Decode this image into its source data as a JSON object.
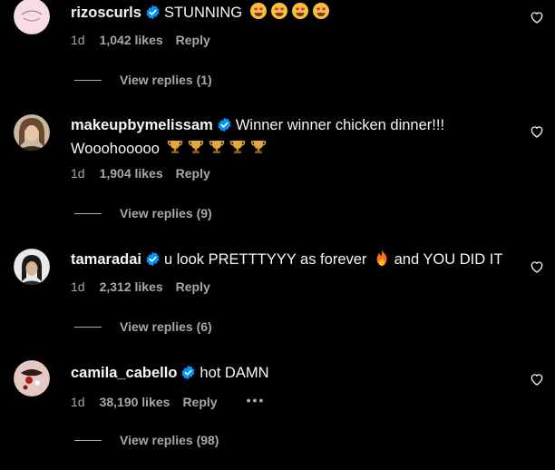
{
  "colors": {
    "background": "#000000",
    "text_primary": "#f5f5f5",
    "text_secondary": "#a8a8a8",
    "verified": "#0095f6"
  },
  "comments": [
    {
      "username": "rizoscurls",
      "verified": true,
      "text": "STUNNING",
      "emoji": [
        "smiling-face-with-heart-eyes",
        "smiling-face-with-heart-eyes",
        "smiling-face-with-heart-eyes",
        "smiling-face-with-heart-eyes"
      ],
      "time": "1d",
      "likes": "1,042 likes",
      "reply_label": "Reply",
      "view_replies": "View replies (1)"
    },
    {
      "username": "makeupbymelissam",
      "verified": true,
      "text": "Winner winner chicken dinner!!!",
      "text_line2": "Wooohooooo",
      "emoji": [
        "trophy",
        "trophy",
        "trophy",
        "trophy",
        "trophy"
      ],
      "time": "1d",
      "likes": "1,904 likes",
      "reply_label": "Reply",
      "view_replies": "View replies (9)"
    },
    {
      "username": "tamaradai",
      "verified": true,
      "text": "u look PRETTTYYY as forever",
      "emoji": [
        "fire"
      ],
      "text_after": "and YOU DID IT",
      "time": "1d",
      "likes": "2,312 likes",
      "reply_label": "Reply",
      "view_replies": "View replies (6)"
    },
    {
      "username": "camila_cabello",
      "verified": true,
      "text": "hot DAMN",
      "time": "1d",
      "likes": "38,190 likes",
      "reply_label": "Reply",
      "more_label": "•••",
      "view_replies": "View replies (98)"
    }
  ]
}
